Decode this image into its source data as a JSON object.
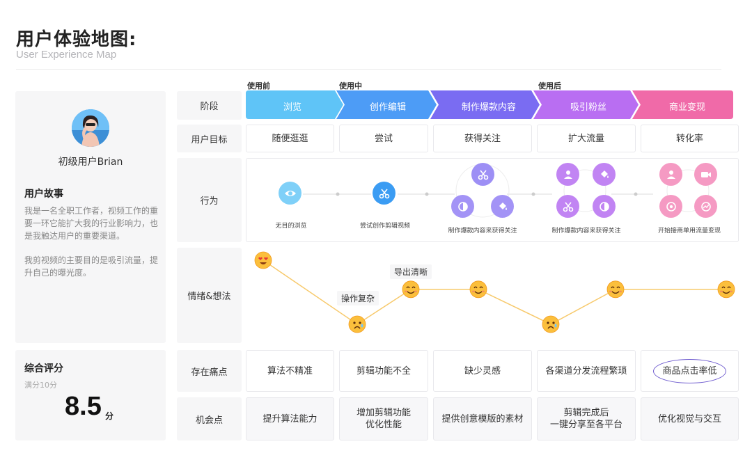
{
  "header": {
    "title": "用户体验地图:",
    "subtitle": "User Experience Map"
  },
  "phases": [
    "使用前",
    "使用中",
    "使用后"
  ],
  "persona": {
    "name": "初级用户Brian",
    "story_title": "用户故事",
    "story_p1": "我是一名全职工作者，视频工作的重要一环它能扩大我的行业影响力，也是我触达用户的重要渠道。",
    "story_p2": "我剪视频的主要目的是吸引流量，提升自己的曝光度。"
  },
  "score": {
    "title": "综合评分",
    "sub": "满分10分",
    "value": "8.5",
    "unit": "分"
  },
  "row_labels": {
    "stage": "阶段",
    "goal": "用户目标",
    "behavior": "行为",
    "emotion": "情绪&想法",
    "pain": "存在痛点",
    "opportunity": "机会点"
  },
  "stages": [
    "浏览",
    "创作编辑",
    "制作爆款内容",
    "吸引粉丝",
    "商业变现"
  ],
  "stage_colors": [
    "#5fc4f7",
    "#4d9cf6",
    "#7a6cf2",
    "#b96ef2",
    "#f06aa8"
  ],
  "goals": [
    "随便逛逛",
    "尝试",
    "获得关注",
    "扩大流量",
    "转化率"
  ],
  "behaviors": [
    "无目的浏览",
    "尝试创作剪辑视频",
    "制作爆款内容来获得关注",
    "制作爆款内容来获得关注",
    "开始接商单用流量变现"
  ],
  "emotion_labels": [
    "操作复杂",
    "导出清晰"
  ],
  "emotion_levels": [
    3,
    0.8,
    2,
    2,
    0.8,
    2,
    2
  ],
  "pains": [
    "算法不精准",
    "剪辑功能不全",
    "缺少灵感",
    "各渠道分发流程繁琐",
    "商品点击率低"
  ],
  "opportunities": [
    [
      "提升算法能力"
    ],
    [
      "增加剪辑功能",
      "优化性能"
    ],
    [
      "提供创意模版的素材"
    ],
    [
      "剪辑完成后",
      "一键分享至各平台"
    ],
    [
      "优化视觉与交互"
    ]
  ],
  "icons": {
    "eye": "eye-icon",
    "scissors": "scissors-icon",
    "contrast": "contrast-icon",
    "paint": "paint-bucket-icon",
    "user": "user-icon",
    "video": "video-icon",
    "coin": "coin-icon",
    "chart": "chart-icon"
  }
}
